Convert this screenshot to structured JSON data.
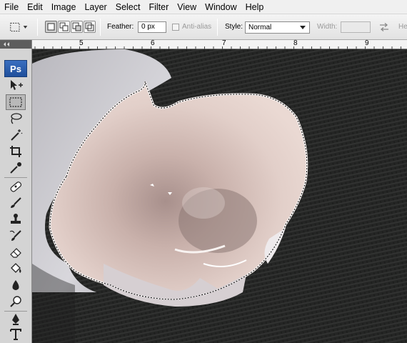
{
  "menu": [
    "File",
    "Edit",
    "Image",
    "Layer",
    "Select",
    "Filter",
    "View",
    "Window",
    "Help"
  ],
  "options": {
    "feather_label": "Feather:",
    "feather_value": "0 px",
    "antialias_label": "Anti-alias",
    "style_label": "Style:",
    "style_value": "Normal",
    "width_label": "Width:",
    "height_label": "He"
  },
  "ruler": {
    "labels": [
      "5",
      "6",
      "7",
      "8",
      "9"
    ]
  },
  "toolbox": {
    "logo": "Ps"
  },
  "icons": {
    "tool_preset": "rect-marquee-icon",
    "tools": [
      "move-icon",
      "rect-marquee-icon",
      "lasso-icon",
      "magic-wand-icon",
      "crop-icon",
      "eyedropper-icon",
      "healing-brush-icon",
      "brush-icon",
      "clone-stamp-icon",
      "history-brush-icon",
      "eraser-icon",
      "paint-bucket-icon",
      "blur-icon",
      "dodge-icon",
      "pen-icon",
      "type-icon"
    ]
  }
}
